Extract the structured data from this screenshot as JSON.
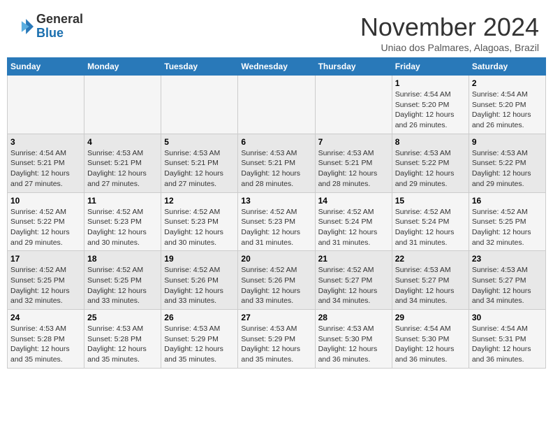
{
  "header": {
    "logo_line1": "General",
    "logo_line2": "Blue",
    "month": "November 2024",
    "location": "Uniao dos Palmares, Alagoas, Brazil"
  },
  "days_of_week": [
    "Sunday",
    "Monday",
    "Tuesday",
    "Wednesday",
    "Thursday",
    "Friday",
    "Saturday"
  ],
  "weeks": [
    {
      "row_bg": "light",
      "days": [
        {
          "num": "",
          "info": ""
        },
        {
          "num": "",
          "info": ""
        },
        {
          "num": "",
          "info": ""
        },
        {
          "num": "",
          "info": ""
        },
        {
          "num": "",
          "info": ""
        },
        {
          "num": "1",
          "info": "Sunrise: 4:54 AM\nSunset: 5:20 PM\nDaylight: 12 hours\nand 26 minutes."
        },
        {
          "num": "2",
          "info": "Sunrise: 4:54 AM\nSunset: 5:20 PM\nDaylight: 12 hours\nand 26 minutes."
        }
      ]
    },
    {
      "row_bg": "dark",
      "days": [
        {
          "num": "3",
          "info": "Sunrise: 4:54 AM\nSunset: 5:21 PM\nDaylight: 12 hours\nand 27 minutes."
        },
        {
          "num": "4",
          "info": "Sunrise: 4:53 AM\nSunset: 5:21 PM\nDaylight: 12 hours\nand 27 minutes."
        },
        {
          "num": "5",
          "info": "Sunrise: 4:53 AM\nSunset: 5:21 PM\nDaylight: 12 hours\nand 27 minutes."
        },
        {
          "num": "6",
          "info": "Sunrise: 4:53 AM\nSunset: 5:21 PM\nDaylight: 12 hours\nand 28 minutes."
        },
        {
          "num": "7",
          "info": "Sunrise: 4:53 AM\nSunset: 5:21 PM\nDaylight: 12 hours\nand 28 minutes."
        },
        {
          "num": "8",
          "info": "Sunrise: 4:53 AM\nSunset: 5:22 PM\nDaylight: 12 hours\nand 29 minutes."
        },
        {
          "num": "9",
          "info": "Sunrise: 4:53 AM\nSunset: 5:22 PM\nDaylight: 12 hours\nand 29 minutes."
        }
      ]
    },
    {
      "row_bg": "light",
      "days": [
        {
          "num": "10",
          "info": "Sunrise: 4:52 AM\nSunset: 5:22 PM\nDaylight: 12 hours\nand 29 minutes."
        },
        {
          "num": "11",
          "info": "Sunrise: 4:52 AM\nSunset: 5:23 PM\nDaylight: 12 hours\nand 30 minutes."
        },
        {
          "num": "12",
          "info": "Sunrise: 4:52 AM\nSunset: 5:23 PM\nDaylight: 12 hours\nand 30 minutes."
        },
        {
          "num": "13",
          "info": "Sunrise: 4:52 AM\nSunset: 5:23 PM\nDaylight: 12 hours\nand 31 minutes."
        },
        {
          "num": "14",
          "info": "Sunrise: 4:52 AM\nSunset: 5:24 PM\nDaylight: 12 hours\nand 31 minutes."
        },
        {
          "num": "15",
          "info": "Sunrise: 4:52 AM\nSunset: 5:24 PM\nDaylight: 12 hours\nand 31 minutes."
        },
        {
          "num": "16",
          "info": "Sunrise: 4:52 AM\nSunset: 5:25 PM\nDaylight: 12 hours\nand 32 minutes."
        }
      ]
    },
    {
      "row_bg": "dark",
      "days": [
        {
          "num": "17",
          "info": "Sunrise: 4:52 AM\nSunset: 5:25 PM\nDaylight: 12 hours\nand 32 minutes."
        },
        {
          "num": "18",
          "info": "Sunrise: 4:52 AM\nSunset: 5:25 PM\nDaylight: 12 hours\nand 33 minutes."
        },
        {
          "num": "19",
          "info": "Sunrise: 4:52 AM\nSunset: 5:26 PM\nDaylight: 12 hours\nand 33 minutes."
        },
        {
          "num": "20",
          "info": "Sunrise: 4:52 AM\nSunset: 5:26 PM\nDaylight: 12 hours\nand 33 minutes."
        },
        {
          "num": "21",
          "info": "Sunrise: 4:52 AM\nSunset: 5:27 PM\nDaylight: 12 hours\nand 34 minutes."
        },
        {
          "num": "22",
          "info": "Sunrise: 4:53 AM\nSunset: 5:27 PM\nDaylight: 12 hours\nand 34 minutes."
        },
        {
          "num": "23",
          "info": "Sunrise: 4:53 AM\nSunset: 5:27 PM\nDaylight: 12 hours\nand 34 minutes."
        }
      ]
    },
    {
      "row_bg": "light",
      "days": [
        {
          "num": "24",
          "info": "Sunrise: 4:53 AM\nSunset: 5:28 PM\nDaylight: 12 hours\nand 35 minutes."
        },
        {
          "num": "25",
          "info": "Sunrise: 4:53 AM\nSunset: 5:28 PM\nDaylight: 12 hours\nand 35 minutes."
        },
        {
          "num": "26",
          "info": "Sunrise: 4:53 AM\nSunset: 5:29 PM\nDaylight: 12 hours\nand 35 minutes."
        },
        {
          "num": "27",
          "info": "Sunrise: 4:53 AM\nSunset: 5:29 PM\nDaylight: 12 hours\nand 35 minutes."
        },
        {
          "num": "28",
          "info": "Sunrise: 4:53 AM\nSunset: 5:30 PM\nDaylight: 12 hours\nand 36 minutes."
        },
        {
          "num": "29",
          "info": "Sunrise: 4:54 AM\nSunset: 5:30 PM\nDaylight: 12 hours\nand 36 minutes."
        },
        {
          "num": "30",
          "info": "Sunrise: 4:54 AM\nSunset: 5:31 PM\nDaylight: 12 hours\nand 36 minutes."
        }
      ]
    }
  ]
}
